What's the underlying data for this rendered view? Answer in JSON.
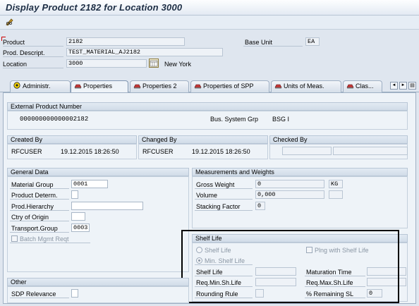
{
  "window": {
    "title": "Display Product 2182 for Location 3000"
  },
  "toolbar": {
    "edit_icon": "pencil-glasses-icon"
  },
  "header": {
    "product_label": "Product",
    "product_value": "2182",
    "desc_label": "Prod. Descript.",
    "desc_value": "TEST_MATERIAL_AJ2182",
    "location_label": "Location",
    "location_value": "3000",
    "location_name": "New York",
    "base_unit_label": "Base Unit",
    "base_unit_value": "EA"
  },
  "tabs": [
    {
      "label": "Administr.",
      "icon": "admin-icon"
    },
    {
      "label": "Properties",
      "icon": "properties-icon"
    },
    {
      "label": "Properties 2",
      "icon": "properties-icon"
    },
    {
      "label": "Properties of SPP",
      "icon": "properties-icon"
    },
    {
      "label": "Units of Meas.",
      "icon": "properties-icon"
    },
    {
      "label": "Clas...",
      "icon": "properties-icon"
    }
  ],
  "active_tab": "Properties",
  "external": {
    "header": "External Product Number",
    "value": "000000000000002182",
    "bus_label": "Bus. System Grp",
    "bus_value": "BSG I"
  },
  "audit": {
    "created_by_label": "Created By",
    "created_user": "RFCUSER",
    "created_date": "19.12.2015 18:26:50",
    "changed_by_label": "Changed By",
    "changed_user": "RFCUSER",
    "changed_date": "19.12.2015 18:26:50",
    "checked_by_label": "Checked By"
  },
  "general": {
    "header": "General Data",
    "material_group_label": "Material Group",
    "material_group_value": "0001",
    "product_determ_label": "Product Determ.",
    "prod_hierarchy_label": "Prod.Hierarchy",
    "ctry_origin_label": "Ctry of Origin",
    "transport_group_label": "Transport.Group",
    "transport_group_value": "0003",
    "batch_mgmt_label": "Batch Mgmt Reqt"
  },
  "measure": {
    "header": "Measurements and Weights",
    "gross_weight_label": "Gross Weight",
    "gross_weight_value": "0",
    "gross_weight_unit": "KG",
    "volume_label": "Volume",
    "volume_value": "0,000",
    "stacking_label": "Stacking Factor",
    "stacking_value": "0"
  },
  "shelf": {
    "header": "Shelf Life",
    "shelf_life_radio": "Shelf Life",
    "plng_label": "Plng with Shelf Life",
    "min_shelf_radio": "Min. Shelf Life",
    "shelf_life_label": "Shelf Life",
    "maturation_label": "Maturation Time",
    "req_min_label": "Req.Min.Sh.Life",
    "req_max_label": "Req.Max.Sh.Life",
    "rounding_label": "Rounding Rule",
    "remaining_label": "% Remaining SL",
    "remaining_value": "0"
  },
  "other": {
    "header": "Other",
    "sdp_label": "SDP Relevance"
  },
  "nav": {
    "left": "◄",
    "right": "►",
    "menu": "▤"
  },
  "colors": {
    "highlight": "#000000",
    "tab_icon_red": "#b03030",
    "admin_icon": "#e8c000"
  }
}
